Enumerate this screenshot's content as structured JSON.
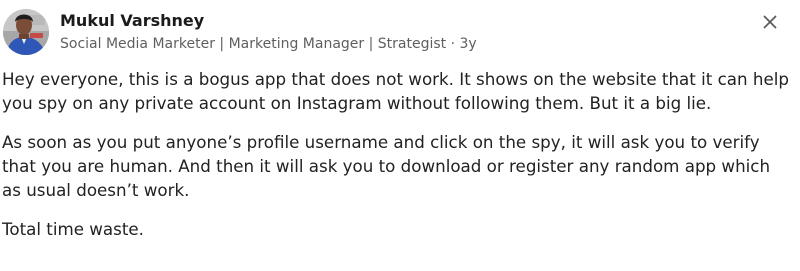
{
  "post": {
    "author": {
      "name": "Mukul Varshney",
      "headline": "Social Media Marketer | Marketing Manager | Strategist",
      "separator": "·",
      "time": "3y"
    },
    "icons": {
      "avatar": "profile-photo",
      "close": "close-icon"
    },
    "paragraphs": [
      "Hey everyone, this is a bogus app that does not work. It shows on the website that it can help you spy on any private account on Instagram without following them. But it a big lie.",
      "As soon as you put anyone’s profile username and click on the spy, it will ask you to verify that you are human. And then it will ask you to download or register any random app which as usual doesn’t work.",
      "Total time waste."
    ]
  }
}
